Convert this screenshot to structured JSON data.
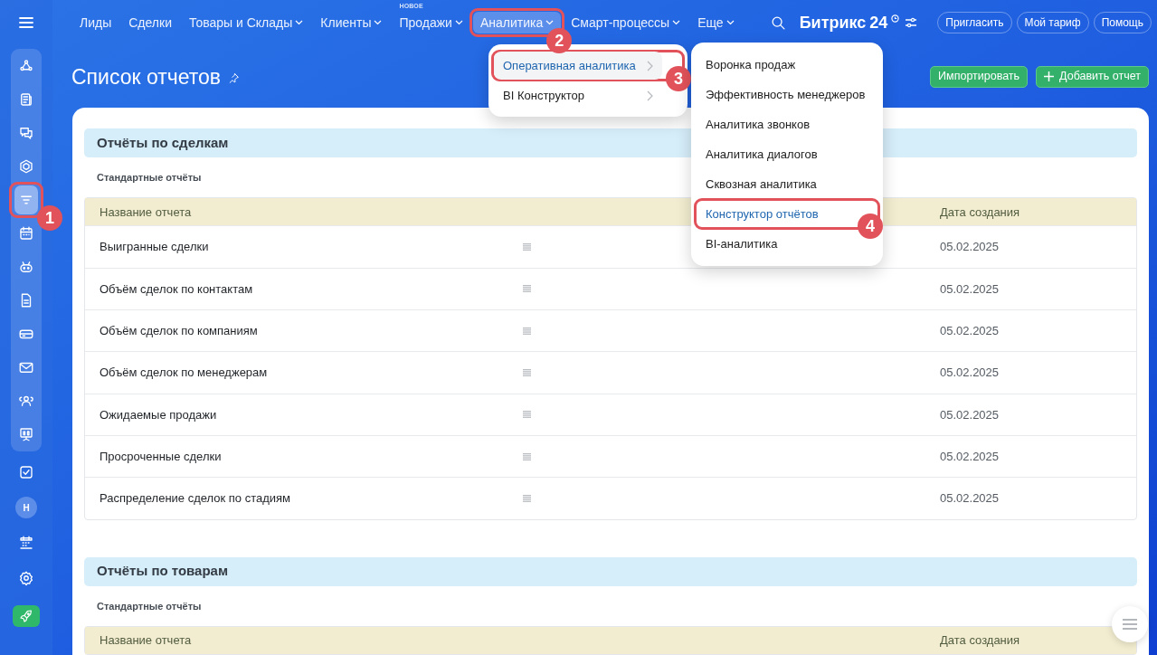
{
  "sidebar": {
    "group_items": [
      {
        "selected": false
      },
      {
        "selected": false
      },
      {
        "selected": false
      },
      {
        "selected": false
      },
      {
        "selected": true,
        "callout": "1"
      },
      {
        "selected": false
      },
      {
        "selected": false
      },
      {
        "selected": false
      },
      {
        "selected": false
      },
      {
        "selected": false
      },
      {
        "selected": false
      },
      {
        "selected": false
      }
    ],
    "avatar_initial": "Н"
  },
  "nav": [
    {
      "label": "Лиды",
      "dropdown": false,
      "selected": false
    },
    {
      "label": "Сделки",
      "dropdown": false,
      "selected": false
    },
    {
      "label": "Товары и Склады",
      "dropdown": true,
      "selected": false
    },
    {
      "label": "Клиенты",
      "dropdown": true,
      "selected": false
    },
    {
      "label": "Продажи",
      "dropdown": true,
      "selected": false,
      "badge": "НОВОЕ"
    },
    {
      "label": "Аналитика",
      "dropdown": true,
      "selected": true,
      "callout": "2"
    },
    {
      "label": "Смарт-процессы",
      "dropdown": true,
      "selected": false
    },
    {
      "label": "Еще",
      "dropdown": true,
      "selected": false
    }
  ],
  "logo": {
    "text": "Битрикс",
    "number": "24"
  },
  "header_buttons": [
    "Пригласить",
    "Мой тариф",
    "Помощь"
  ],
  "page_title": "Список отчетов",
  "actions": [
    {
      "label": "Импортировать",
      "kind": "plain"
    },
    {
      "label": "Добавить отчет",
      "kind": "add"
    }
  ],
  "menu": [
    {
      "label": "Оперативная аналитика",
      "selected": true,
      "callout": "3"
    },
    {
      "label": "BI Конструктор",
      "selected": false
    }
  ],
  "submenu": [
    {
      "label": "Воронка продаж",
      "selected": false
    },
    {
      "label": "Эффективность менеджеров",
      "selected": false
    },
    {
      "label": "Аналитика звонков",
      "selected": false
    },
    {
      "label": "Аналитика диалогов",
      "selected": false
    },
    {
      "label": "Сквозная аналитика",
      "selected": false
    },
    {
      "label": "Конструктор отчётов",
      "selected": true,
      "callout": "4"
    },
    {
      "label": "BI-аналитика",
      "selected": false
    }
  ],
  "sections": [
    {
      "title": "Отчёты по сделкам",
      "subtitle": "Стандартные отчёты",
      "columns": [
        "Название отчета",
        "Дата создания"
      ],
      "rows": [
        {
          "name": "Выигранные сделки",
          "date": "05.02.2025"
        },
        {
          "name": "Объём сделок по контактам",
          "date": "05.02.2025"
        },
        {
          "name": "Объём сделок по компаниям",
          "date": "05.02.2025"
        },
        {
          "name": "Объём сделок по менеджерам",
          "date": "05.02.2025"
        },
        {
          "name": "Ожидаемые продажи",
          "date": "05.02.2025"
        },
        {
          "name": "Просроченные сделки",
          "date": "05.02.2025"
        },
        {
          "name": "Распределение сделок по стадиям",
          "date": "05.02.2025"
        }
      ]
    },
    {
      "title": "Отчёты по товарам",
      "subtitle": "Стандартные отчёты",
      "columns": [
        "Название отчета",
        "Дата создания"
      ]
    }
  ]
}
